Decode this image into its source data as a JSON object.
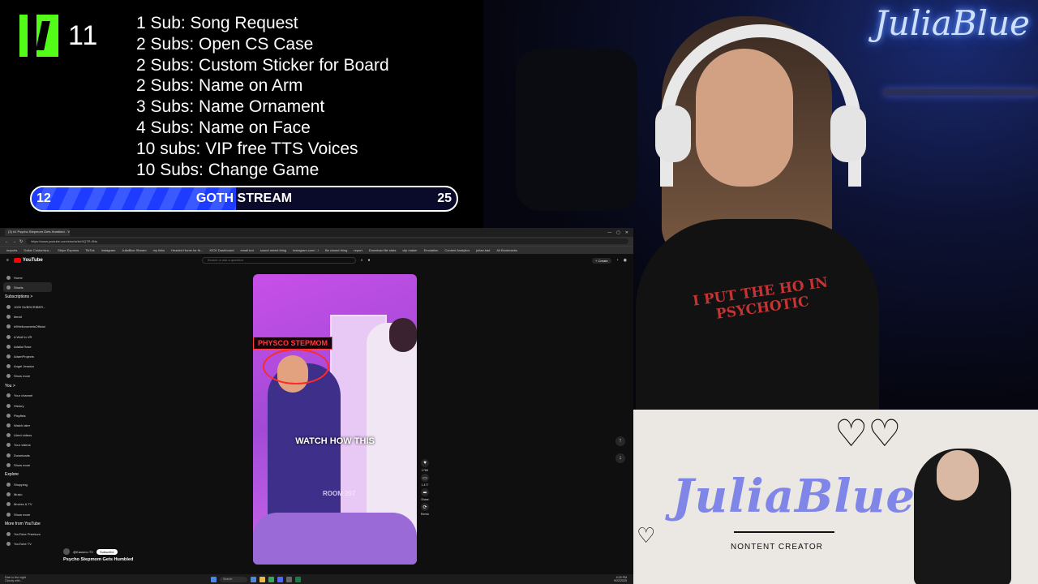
{
  "kick": {
    "icon": "kick-logo",
    "count": "11"
  },
  "sub_goals": [
    "1 Sub: Song Request",
    "2 Subs: Open CS Case",
    "2 Subs: Custom Sticker for Board",
    "2 Subs: Name on Arm",
    "3 Subs: Name Ornament",
    "4 Subs: Name on Face",
    "10 subs: VIP free TTS Voices",
    "10 Subs: Change Game"
  ],
  "goal_bar": {
    "current": "12",
    "target": "25",
    "title": "GOTH STREAM",
    "progress": 0.48,
    "fill_color": "#1e3cff"
  },
  "webcam": {
    "neon_sign": "JuliaBlue",
    "shirt_text": "I PUT THE HO IN PSYCHOTIC"
  },
  "branding": {
    "name": "JuliaBlue",
    "tagline": "NONTENT CREATOR",
    "accent_color": "#7f86e8"
  },
  "browser": {
    "active_tab": "(3) #1 Psycho Stepmom Gets Humbled - YouTube",
    "url": "https://www.youtube.com/shorts/brtXQTR-9Ns",
    "window_controls": [
      "—",
      "▢",
      "✕"
    ],
    "bookmarks": [
      "Imports",
      "Dollar Customiza...",
      "Stripe Express",
      "TikTok",
      "Instagram",
      "JuliaBlue Stream",
      "my links",
      "Headed Home for th...",
      "KICK Dashboard",
      "email bot",
      "sound mixed thing",
      "instagram.com/.../",
      "Be closed thing",
      "report",
      "Download file stats",
      "clip maker",
      "Emulation",
      "Content Analytics",
      "juliaa.bad",
      "All Bookmarks"
    ]
  },
  "youtube": {
    "logo": "YouTube",
    "search_placeholder": "Search or ask a question",
    "create_label": "+ Create",
    "sidebar": {
      "primary": [
        {
          "label": "Home",
          "icon": "home-icon"
        },
        {
          "label": "Shorts",
          "icon": "shorts-icon"
        }
      ],
      "subscriptions_heading": "Subscriptions >",
      "subscriptions": [
        "1000 SUBSCRIBER...",
        "ibedd",
        "#9HelloromieisOfficial",
        "A Wolf in VR",
        "Adalia Rose",
        "AdamProjects",
        "Angel Jessica",
        "Show more"
      ],
      "you_heading": "You >",
      "you": [
        "Your channel",
        "History",
        "Playlists",
        "Watch later",
        "Liked videos",
        "Your videos",
        "Downloads",
        "Show more"
      ],
      "explore_heading": "Explore",
      "explore": [
        "Shopping",
        "Music",
        "Movies & TV",
        "Show more"
      ],
      "more_heading": "More from YouTube",
      "more": [
        "YouTube Premium",
        "YouTube TV"
      ]
    },
    "short": {
      "label": "PHYSCO STEPMOM",
      "caption": "WATCH HOW THIS",
      "room_sign": "ROOM 207",
      "channel": "@Kaosmo.TV",
      "subscribe_label": "Subscribe",
      "title": "Psycho Stepmom Gets Humbled",
      "actions": [
        {
          "icon": "like-icon",
          "count": "176K"
        },
        {
          "icon": "comment-icon",
          "count": "1,477"
        },
        {
          "icon": "share-icon",
          "count": "Share"
        },
        {
          "icon": "remix-icon",
          "count": "Remix"
        }
      ]
    }
  },
  "taskbar": {
    "left_line1": "Rain in the night",
    "left_line2": "Cloudy with...",
    "search_label": "Search",
    "time": "4:29 PM",
    "date": "9/22/2025"
  }
}
